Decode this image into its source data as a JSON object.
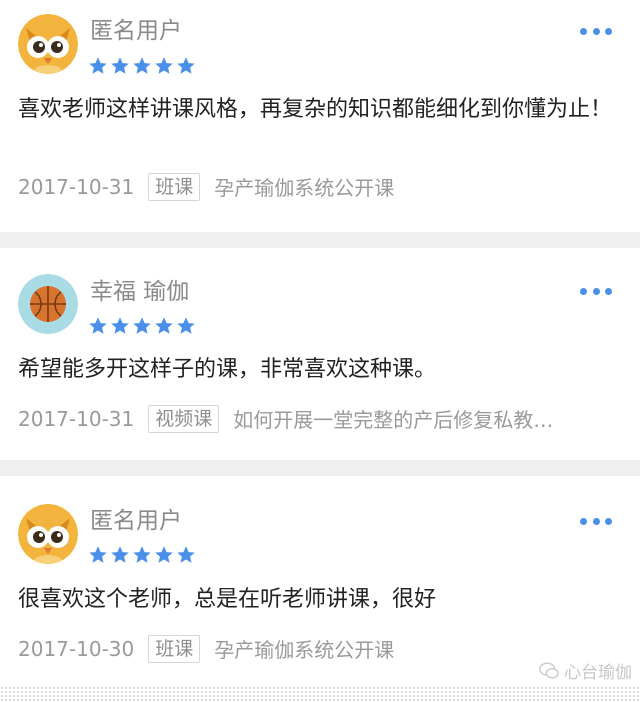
{
  "reviews": [
    {
      "name": "匿名用户",
      "avatar": "owl-avatar",
      "rating": 5,
      "comment": "喜欢老师这样讲课风格，再复杂的知识都能细化到你懂为止！",
      "date": "2017-10-31",
      "tag": "班课",
      "course": "孕产瑜伽系统公开课"
    },
    {
      "name": "幸福 瑜伽",
      "avatar": "basketball-avatar",
      "rating": 5,
      "comment": "希望能多开这样子的课，非常喜欢这种课。",
      "date": "2017-10-31",
      "tag": "视频课",
      "course": "如何开展一堂完整的产后修复私教…"
    },
    {
      "name": "匿名用户",
      "avatar": "owl-avatar",
      "rating": 5,
      "comment": "很喜欢这个老师，总是在听老师讲课，很好",
      "date": "2017-10-30",
      "tag": "班课",
      "course": "孕产瑜伽系统公开课"
    }
  ],
  "watermark": {
    "text": "心台瑜伽"
  },
  "colors": {
    "star": "#4a8fe8",
    "more": "#4a8fe8",
    "gap": "#efefef"
  }
}
